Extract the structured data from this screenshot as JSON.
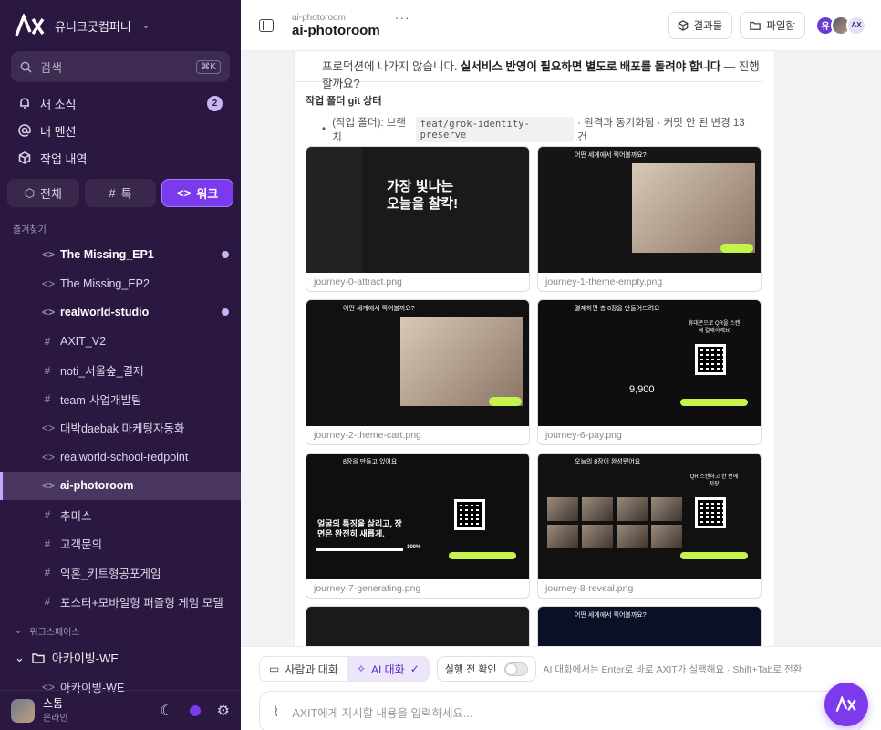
{
  "sidebar": {
    "workspace": "유니크굿컴퍼니",
    "search_placeholder": "검색",
    "search_shortcut": "⌘K",
    "nav": [
      {
        "label": "새 소식",
        "badge": "2"
      },
      {
        "label": "내 멘션"
      },
      {
        "label": "작업 내역"
      }
    ],
    "tabs": [
      "전체",
      "톡",
      "워크"
    ],
    "favorites_title": "즐겨찾기",
    "channels": [
      {
        "label": "The Missing_EP1",
        "icon": "code",
        "bold": true,
        "dot": true
      },
      {
        "label": "The Missing_EP2",
        "icon": "code"
      },
      {
        "label": "realworld-studio",
        "icon": "code",
        "bold": true,
        "dot": true
      },
      {
        "label": "AXIT_V2",
        "icon": "hash"
      },
      {
        "label": "noti_서울숲_결제",
        "icon": "hash"
      },
      {
        "label": "team-사업개발팀",
        "icon": "hash"
      },
      {
        "label": "대박daebak 마케팅자동화",
        "icon": "code"
      },
      {
        "label": "realworld-school-redpoint",
        "icon": "code"
      },
      {
        "label": "ai-photoroom",
        "icon": "code",
        "selected": true
      },
      {
        "label": "추미스",
        "icon": "hash"
      },
      {
        "label": "고객문의",
        "icon": "hash"
      },
      {
        "label": "익혼_키트형공포게임",
        "icon": "hash"
      },
      {
        "label": "포스터+모바일형 퍼즐형 게임 모델",
        "icon": "hash"
      }
    ],
    "workspace_title": "워크스페이스",
    "folder": "아카이빙-WE",
    "folder_child": "아카이빙-WE",
    "user": {
      "name": "스톰",
      "status": "온라인"
    }
  },
  "header": {
    "crumb": "ai-photoroom",
    "title": "ai-photoroom",
    "results": "결과물",
    "files": "파일함",
    "avatars": [
      "유",
      "",
      "AX"
    ]
  },
  "content": {
    "line_pre": "프로덕션에 나가지 않습니다. ",
    "line_bold": "실서비스 반영이 필요하면 별도로 배포를 돌려야 합니다",
    "line_post": " — 진행할까요?",
    "git_title": "작업 폴더 git 상태",
    "git_pre": "(작업 폴더): 브랜치 ",
    "branch": "feat/grok-identity-preserve",
    "git_post": " · 원격과 동기화됨 · 커밋 안 된 변경 13건",
    "images": [
      {
        "file": "journey-0-attract.png",
        "text": "가장 빛나는 오늘을 찰칵!"
      },
      {
        "file": "journey-1-theme-empty.png",
        "text": "어떤 세계에서 찍어볼까요?"
      },
      {
        "file": "journey-2-theme-cart.png",
        "text": "어떤 세계에서 찍어볼까요?"
      },
      {
        "file": "journey-6-pay.png",
        "text": "결제하면 총 8장을 만들어드려요",
        "price": "9,900",
        "qr": "휴대폰으로 QR을 스캔해 결제하세요"
      },
      {
        "file": "journey-7-generating.png",
        "text": "8장을 만들고 있어요",
        "sub": "얼굴의 특징을 살리고, 장면은 완전히 새롭게.",
        "pct": "100%"
      },
      {
        "file": "journey-8-reveal.png",
        "text": "오늘의 8장이 완성됐어요",
        "qr": "QR 스캔하고 한 번에 저장"
      },
      {
        "file": "",
        "text": ""
      },
      {
        "file": "",
        "text": "어떤 세계에서 찍어볼까요?"
      }
    ]
  },
  "composer": {
    "human": "사람과 대화",
    "ai": "AI 대화",
    "precheck": "실행 전 확인",
    "hint": "AI 대화에서는 Enter로 바로 AXIT가 실행해요 · Shift+Tab로 전환",
    "placeholder": "AXIT에게 지시할 내용을 입력하세요..."
  },
  "colors": {
    "sidebar": "#2b1840",
    "accent": "#7c3aed",
    "lime": "#c6f24e"
  }
}
